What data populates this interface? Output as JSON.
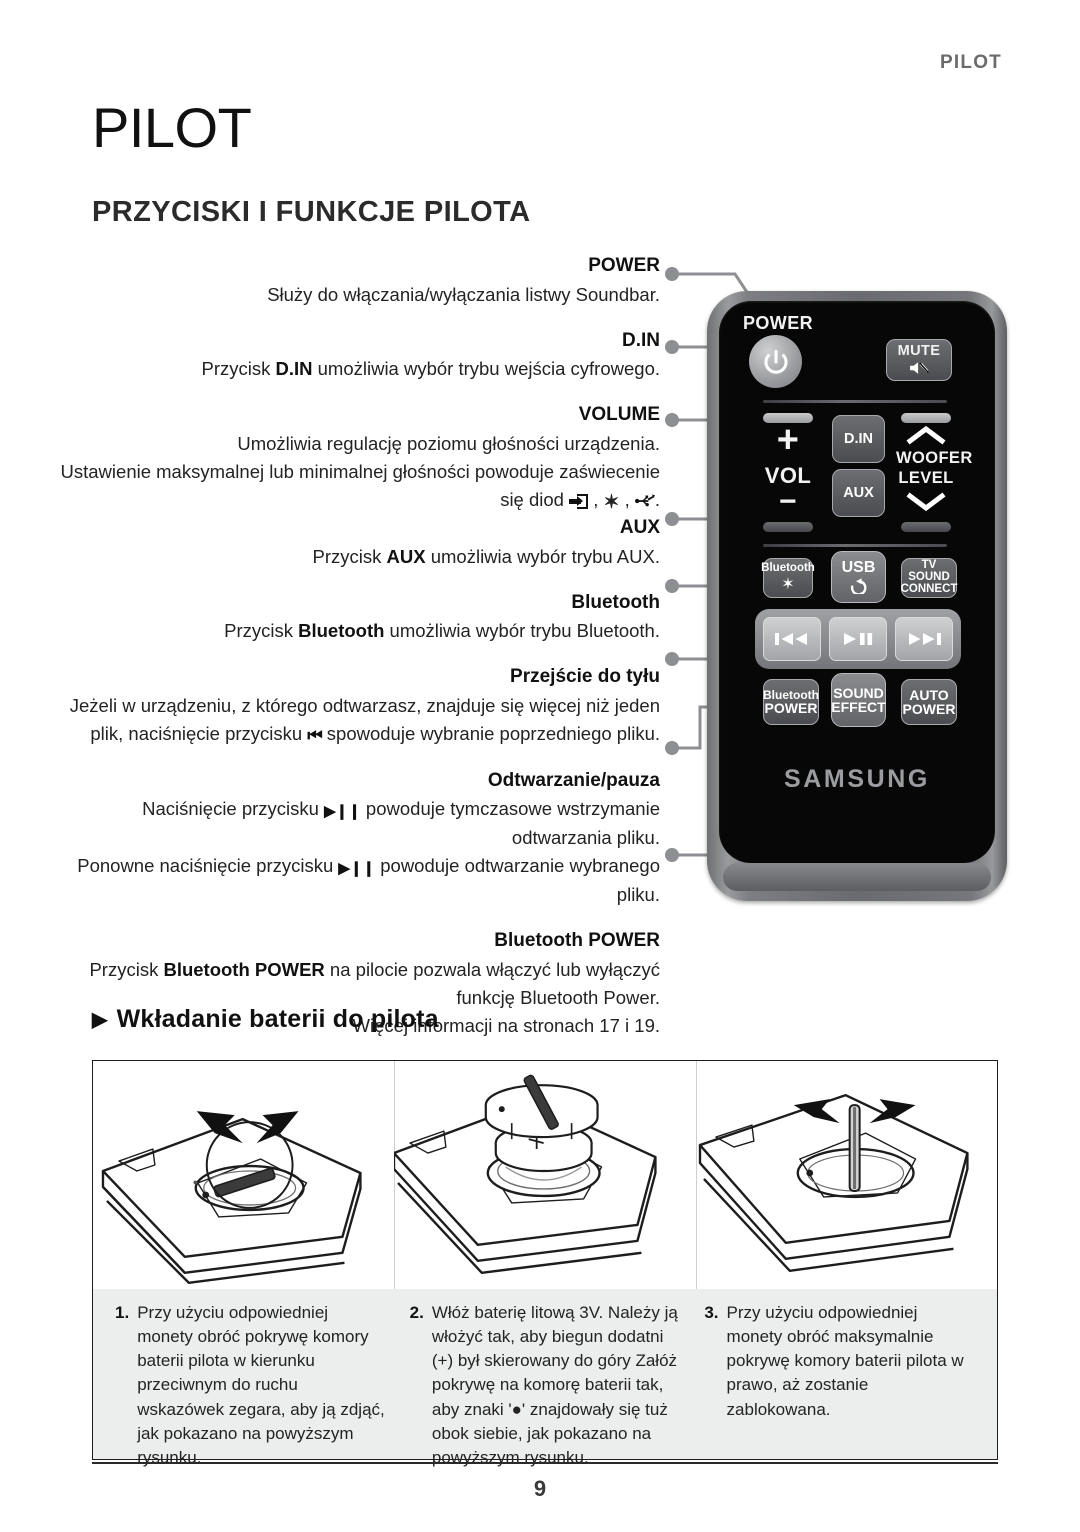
{
  "running_head": "PILOT",
  "chapter_title": "PILOT",
  "section_title": "PRZYCISKI I FUNKCJE PILOTA",
  "callouts": [
    {
      "label": "POWER",
      "lines": [
        "Służy do włączania/wyłączania listwy Soundbar."
      ]
    },
    {
      "label": "D.IN",
      "lines": [
        "Przycisk D.IN umożliwia wybór trybu wejścia cyfrowego."
      ]
    },
    {
      "label": "VOLUME",
      "lines": [
        "Umożliwia regulację poziomu głośności urządzenia.",
        "Ustawienie maksymalnej lub minimalnej głośności powoduje zaświecenie",
        "się diod , , ."
      ]
    },
    {
      "label": "AUX",
      "lines": [
        "Przycisk AUX umożliwia wybór trybu AUX."
      ]
    },
    {
      "label": "Bluetooth",
      "lines": [
        "Przycisk Bluetooth umożliwia wybór trybu Bluetooth."
      ]
    },
    {
      "label": "Przejście do tyłu",
      "lines": [
        "Jeżeli w urządzeniu, z którego odtwarzasz, znajduje się więcej niż jeden",
        "plik, naciśnięcie przycisku spowoduje wybranie poprzedniego pliku."
      ]
    },
    {
      "label": "Odtwarzanie/pauza",
      "lines": [
        "Naciśnięcie przycisku powoduje tymczasowe wstrzymanie odtwarzania pliku.",
        "Ponowne naciśnięcie przycisku powoduje odtwarzanie wybranego pliku."
      ]
    },
    {
      "label": "Bluetooth POWER",
      "lines": [
        "Przycisk Bluetooth POWER na pilocie pozwala włączyć lub wyłączyć",
        "funkcję Bluetooth Power.",
        "Więcej informacji na stronach 17 i 19."
      ]
    }
  ],
  "text_fragments": {
    "power_desc": "Służy do włączania/wyłączania listwy Soundbar.",
    "din_pre": "Przycisk ",
    "din_bold": "D.IN",
    "din_post": " umożliwia wybór trybu wejścia cyfrowego.",
    "vol_l1": "Umożliwia regulację poziomu głośności urządzenia.",
    "vol_l2": "Ustawienie maksymalnej lub minimalnej głośności powoduje zaświecenie",
    "vol_l3_pre": "się diod ",
    "vol_sep1": " , ",
    "vol_sep2": " , ",
    "vol_end": ".",
    "aux_pre": "Przycisk ",
    "aux_bold": "AUX",
    "aux_post": " umożliwia wybór trybu AUX.",
    "bt_pre": "Przycisk ",
    "bt_bold": "Bluetooth",
    "bt_post": " umożliwia wybór trybu Bluetooth.",
    "prev_l1": "Jeżeli w urządzeniu, z którego odtwarzasz, znajduje się więcej niż jeden",
    "prev_l2a": "plik, naciśnięcie przycisku ",
    "prev_l2b": " spowoduje wybranie poprzedniego pliku.",
    "play_l1a": "Naciśnięcie przycisku ",
    "play_l1b": " powoduje tymczasowe wstrzymanie odtwarzania pliku.",
    "play_l2a": "Ponowne naciśnięcie przycisku ",
    "play_l2b": " powoduje odtwarzanie wybranego pliku.",
    "btp_l1a": "Przycisk ",
    "btp_l1b": "Bluetooth POWER",
    "btp_l1c": " na pilocie pozwala włączyć lub wyłączyć",
    "btp_l2": "funkcję Bluetooth Power.",
    "btp_l3": "Więcej informacji na stronach 17 i 19."
  },
  "remote": {
    "brand": "SAMSUNG",
    "power_label": "POWER",
    "buttons": {
      "mute": "MUTE",
      "din": "D.IN",
      "aux": "AUX",
      "vol": "VOL",
      "vol_plus": "+",
      "vol_minus": "−",
      "woofer_line1": "WOOFER",
      "woofer_line2": "LEVEL",
      "bluetooth": "Bluetooth",
      "usb": "USB",
      "tv_sound_line1": "TV SOUND",
      "tv_sound_line2": "CONNECT",
      "prev": "prev-track-icon",
      "play_pause": "play-pause-icon",
      "next": "next-track-icon",
      "bt_power_line1": "Bluetooth",
      "bt_power_line2": "POWER",
      "sound_effect_line1": "SOUND",
      "sound_effect_line2": "EFFECT",
      "auto_power_line1": "AUTO",
      "auto_power_line2": "POWER"
    }
  },
  "battery_section": {
    "heading": "Wkładanie baterii do pilota",
    "heading_arrow": "▶",
    "steps": [
      {
        "num": "1.",
        "text": "Przy użyciu odpowiedniej monety obróć pokrywę komory baterii pilota w kierunku przeciwnym do ruchu wskazówek zegara, aby ją zdjąć, jak pokazano na powyższym rysunku."
      },
      {
        "num": "2.",
        "text": "Włóż baterię litową 3V. Należy ją włożyć tak, aby biegun dodatni (+) był skierowany do góry Załóż pokrywę na komorę baterii tak, aby znaki '●' znajdowały się tuż obok siebie, jak pokazano na powyższym rysunku."
      },
      {
        "num": "3.",
        "text": "Przy użyciu odpowiedniej monety obróć maksymalnie pokrywę komory baterii pilota w prawo, aż zostanie zablokowana."
      }
    ]
  },
  "page_number": "9",
  "colors": {
    "running_head": "#6b6b6b",
    "body_text": "#232323",
    "remote_face": "#070708",
    "caption_bg": "#eceded",
    "leader_line": "#8e8f92"
  }
}
